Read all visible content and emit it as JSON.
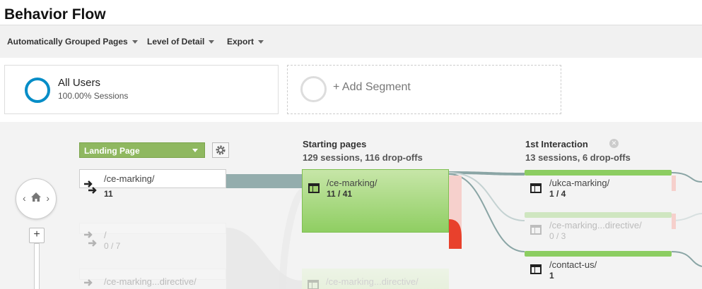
{
  "title": "Behavior Flow",
  "toolbar": {
    "grouped": "Automatically Grouped Pages",
    "detail": "Level of Detail",
    "export": "Export"
  },
  "segments": {
    "active": {
      "name": "All Users",
      "sub": "100.00% Sessions"
    },
    "add_label": "+ Add Segment"
  },
  "flow": {
    "dimension": "Landing Page",
    "starting": {
      "title": "Starting pages",
      "sub": "129 sessions, 116 drop-offs"
    },
    "interaction": {
      "title": "1st Interaction",
      "sub": "13 sessions, 6 drop-offs"
    },
    "landing_nodes": [
      {
        "label": "/ce-marking/",
        "value": "11"
      },
      {
        "label": "/",
        "value": "0 / 7"
      },
      {
        "label": "/ce-marking...directive/",
        "value": ""
      }
    ],
    "start_nodes": [
      {
        "label": "/ce-marking/",
        "value": "11 / 41"
      },
      {
        "label": "/ce-marking...directive/",
        "value": ""
      }
    ],
    "interaction_nodes": [
      {
        "label": "/ukca-marking/",
        "value": "1 / 4"
      },
      {
        "label": "/ce-marking...directive/",
        "value": "0 / 3"
      },
      {
        "label": "/contact-us/",
        "value": "1"
      }
    ],
    "zoom_in": "+"
  },
  "colors": {
    "segment_ring": "#058dc7",
    "node_green": "#8fce62",
    "dropoff_red": "#e8412c",
    "flow_link": "#8aa5a5"
  }
}
